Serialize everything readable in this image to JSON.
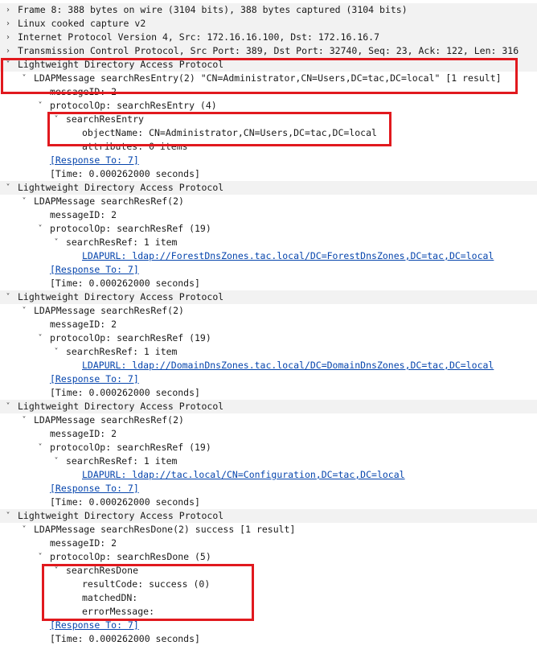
{
  "accent_colors": {
    "highlight": "#e1191e",
    "link": "#0645ad"
  },
  "tree": [
    {
      "level": 0,
      "toggle": "collapsed",
      "text": "Frame 8: 388 bytes on wire (3104 bits), 388 bytes captured (3104 bits)"
    },
    {
      "level": 0,
      "toggle": "collapsed",
      "text": "Linux cooked capture v2"
    },
    {
      "level": 0,
      "toggle": "collapsed",
      "text": "Internet Protocol Version 4, Src: 172.16.16.100, Dst: 172.16.16.7"
    },
    {
      "level": 0,
      "toggle": "collapsed",
      "text": "Transmission Control Protocol, Src Port: 389, Dst Port: 32740, Seq: 23, Ack: 122, Len: 316"
    },
    {
      "level": 0,
      "toggle": "expanded",
      "text": "Lightweight Directory Access Protocol"
    },
    {
      "level": 1,
      "toggle": "expanded",
      "text": "LDAPMessage searchResEntry(2) \"CN=Administrator,CN=Users,DC=tac,DC=local\" [1 result]"
    },
    {
      "level": 2,
      "toggle": "none",
      "text": "messageID: 2"
    },
    {
      "level": 2,
      "toggle": "expanded",
      "text": "protocolOp: searchResEntry (4)"
    },
    {
      "level": 3,
      "toggle": "expanded",
      "text": "searchResEntry"
    },
    {
      "level": 4,
      "toggle": "none",
      "text": "objectName: CN=Administrator,CN=Users,DC=tac,DC=local"
    },
    {
      "level": 4,
      "toggle": "none",
      "text": "attributes: 0 items"
    },
    {
      "level": 2,
      "toggle": "none",
      "text": "[Response To: 7]",
      "link": true
    },
    {
      "level": 2,
      "toggle": "none",
      "text": "[Time: 0.000262000 seconds]"
    },
    {
      "level": 0,
      "toggle": "expanded",
      "text": "Lightweight Directory Access Protocol"
    },
    {
      "level": 1,
      "toggle": "expanded",
      "text": "LDAPMessage searchResRef(2)"
    },
    {
      "level": 2,
      "toggle": "none",
      "text": "messageID: 2"
    },
    {
      "level": 2,
      "toggle": "expanded",
      "text": "protocolOp: searchResRef (19)"
    },
    {
      "level": 3,
      "toggle": "expanded",
      "text": "searchResRef: 1 item"
    },
    {
      "level": 4,
      "toggle": "none",
      "text": "LDAPURL: ldap://ForestDnsZones.tac.local/DC=ForestDnsZones,DC=tac,DC=local",
      "link": true
    },
    {
      "level": 2,
      "toggle": "none",
      "text": "[Response To: 7]",
      "link": true
    },
    {
      "level": 2,
      "toggle": "none",
      "text": "[Time: 0.000262000 seconds]"
    },
    {
      "level": 0,
      "toggle": "expanded",
      "text": "Lightweight Directory Access Protocol"
    },
    {
      "level": 1,
      "toggle": "expanded",
      "text": "LDAPMessage searchResRef(2)"
    },
    {
      "level": 2,
      "toggle": "none",
      "text": "messageID: 2"
    },
    {
      "level": 2,
      "toggle": "expanded",
      "text": "protocolOp: searchResRef (19)"
    },
    {
      "level": 3,
      "toggle": "expanded",
      "text": "searchResRef: 1 item"
    },
    {
      "level": 4,
      "toggle": "none",
      "text": "LDAPURL: ldap://DomainDnsZones.tac.local/DC=DomainDnsZones,DC=tac,DC=local",
      "link": true
    },
    {
      "level": 2,
      "toggle": "none",
      "text": "[Response To: 7]",
      "link": true
    },
    {
      "level": 2,
      "toggle": "none",
      "text": "[Time: 0.000262000 seconds]"
    },
    {
      "level": 0,
      "toggle": "expanded",
      "text": "Lightweight Directory Access Protocol"
    },
    {
      "level": 1,
      "toggle": "expanded",
      "text": "LDAPMessage searchResRef(2)"
    },
    {
      "level": 2,
      "toggle": "none",
      "text": "messageID: 2"
    },
    {
      "level": 2,
      "toggle": "expanded",
      "text": "protocolOp: searchResRef (19)"
    },
    {
      "level": 3,
      "toggle": "expanded",
      "text": "searchResRef: 1 item"
    },
    {
      "level": 4,
      "toggle": "none",
      "text": "LDAPURL: ldap://tac.local/CN=Configuration,DC=tac,DC=local",
      "link": true
    },
    {
      "level": 2,
      "toggle": "none",
      "text": "[Response To: 7]",
      "link": true
    },
    {
      "level": 2,
      "toggle": "none",
      "text": "[Time: 0.000262000 seconds]"
    },
    {
      "level": 0,
      "toggle": "expanded",
      "text": "Lightweight Directory Access Protocol"
    },
    {
      "level": 1,
      "toggle": "expanded",
      "text": "LDAPMessage searchResDone(2) success [1 result]"
    },
    {
      "level": 2,
      "toggle": "none",
      "text": "messageID: 2"
    },
    {
      "level": 2,
      "toggle": "expanded",
      "text": "protocolOp: searchResDone (5)"
    },
    {
      "level": 3,
      "toggle": "expanded",
      "text": "searchResDone"
    },
    {
      "level": 4,
      "toggle": "none",
      "text": "resultCode: success (0)"
    },
    {
      "level": 4,
      "toggle": "none",
      "text": "matchedDN:"
    },
    {
      "level": 4,
      "toggle": "none",
      "text": "errorMessage:"
    },
    {
      "level": 2,
      "toggle": "none",
      "text": "[Response To: 7]",
      "link": true
    },
    {
      "level": 2,
      "toggle": "none",
      "text": "[Time: 0.000262000 seconds]"
    }
  ],
  "icons": {
    "expanded": "chevron-down-icon",
    "collapsed": "chevron-right-icon"
  }
}
